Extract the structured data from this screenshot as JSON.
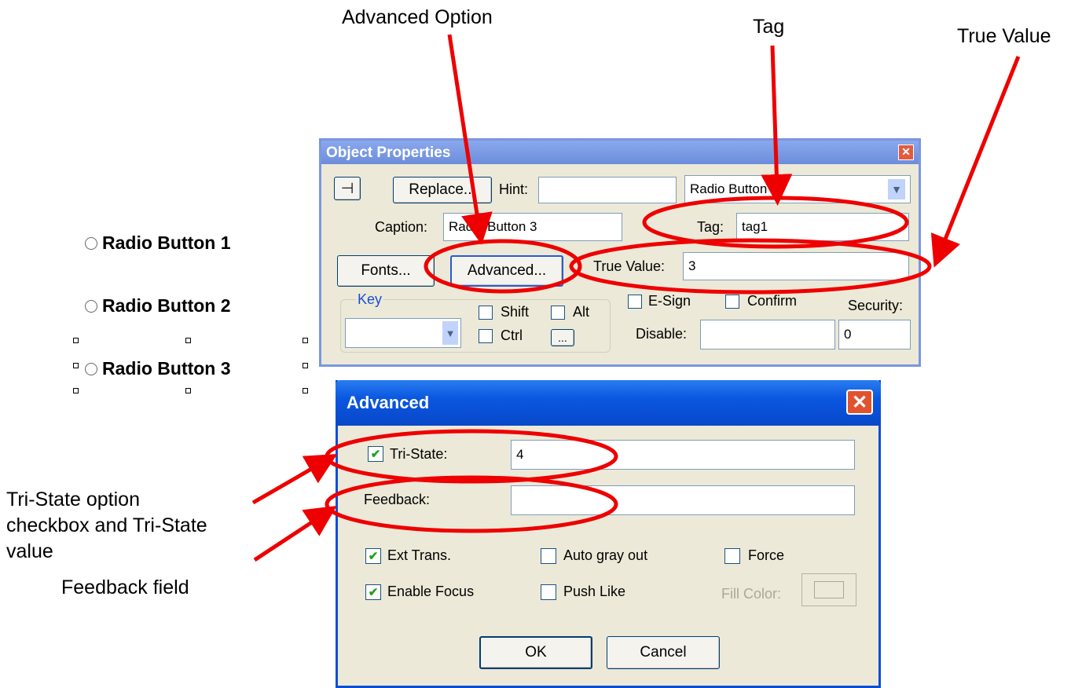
{
  "callouts": {
    "advanced_option": "Advanced Option",
    "tag": "Tag",
    "true_value": "True Value",
    "tristate_line1": "Tri-State option",
    "tristate_line2": "checkbox and Tri-State",
    "tristate_line3": "value",
    "feedback_field": "Feedback field"
  },
  "canvas": {
    "radios": [
      "Radio Button 1",
      "Radio Button 2",
      "Radio Button 3"
    ]
  },
  "object_properties": {
    "title": "Object Properties",
    "close_glyph": "✕",
    "pin_glyph": "⊣",
    "replace_label": "Replace...",
    "hint_label": "Hint:",
    "hint_value": "",
    "type_value": "Radio Button",
    "caption_label": "Caption:",
    "caption_value": "Radio Button 3",
    "tag_label": "Tag:",
    "tag_value": "tag1",
    "fonts_label": "Fonts...",
    "advanced_label": "Advanced...",
    "true_value_label": "True Value:",
    "true_value": "3",
    "key_label": "Key",
    "shift_label": "Shift",
    "alt_label": "Alt",
    "ctrl_label": "Ctrl",
    "ellipsis_label": "...",
    "esign_label": "E-Sign",
    "confirm_label": "Confirm",
    "security_label": "Security:",
    "security_value": "0",
    "disable_label": "Disable:",
    "disable_value": ""
  },
  "advanced": {
    "title": "Advanced",
    "close_glyph": "✕",
    "tristate_label": "Tri-State:",
    "tristate_checked": true,
    "tristate_value": "4",
    "feedback_label": "Feedback:",
    "feedback_value": "",
    "ext_trans_label": "Ext Trans.",
    "ext_trans_checked": true,
    "auto_gray_label": "Auto gray out",
    "auto_gray_checked": false,
    "force_label": "Force",
    "force_checked": false,
    "enable_focus_label": "Enable Focus",
    "enable_focus_checked": true,
    "push_like_label": "Push Like",
    "push_like_checked": false,
    "fill_color_label": "Fill Color:",
    "ok_label": "OK",
    "cancel_label": "Cancel"
  },
  "colors": {
    "annotation_red": "#ee0000",
    "checkmark_green": "#21a121"
  }
}
